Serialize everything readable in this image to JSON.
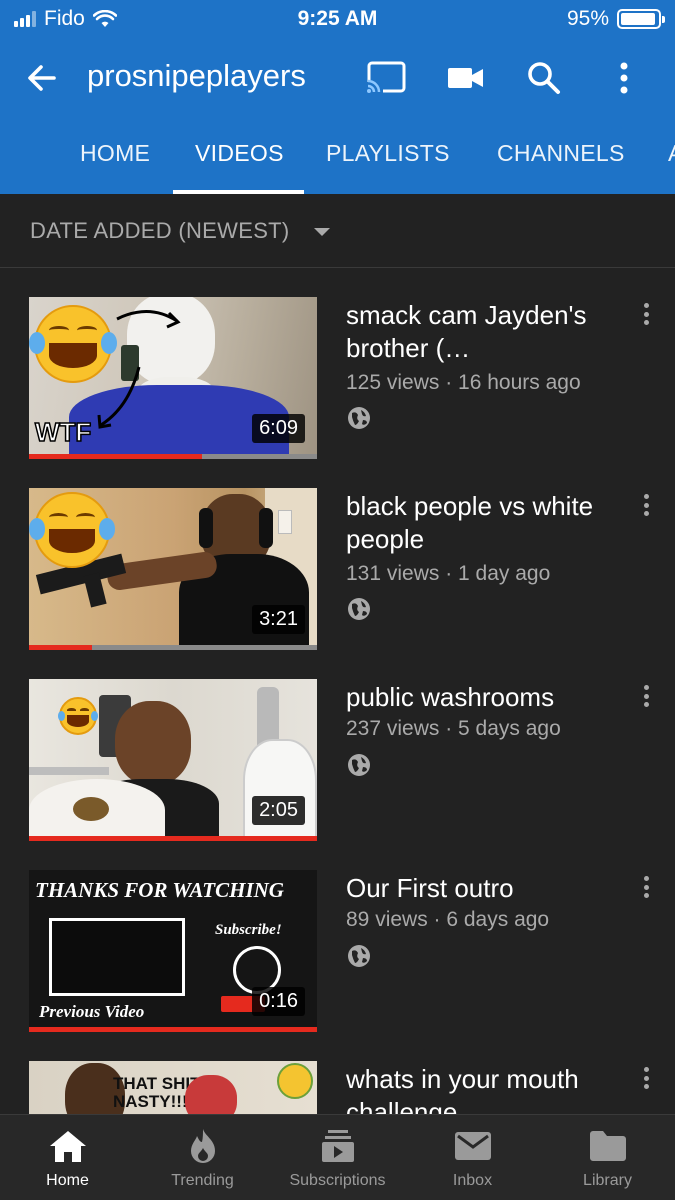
{
  "status": {
    "carrier": "Fido",
    "time": "9:25 AM",
    "battery": "95%",
    "battery_level": 0.95
  },
  "header": {
    "title": "prosnipeplayers"
  },
  "tabs": [
    {
      "label": "HOME"
    },
    {
      "label": "VIDEOS"
    },
    {
      "label": "PLAYLISTS"
    },
    {
      "label": "CHANNELS"
    }
  ],
  "sort": {
    "label": "DATE ADDED (NEWEST)"
  },
  "videos": [
    {
      "title": "smack cam Jayden's  brother (…",
      "meta": "125 views · 16 hours ago",
      "duration": "6:09",
      "progress": 0.6,
      "thumb_text": "WTF"
    },
    {
      "title": "black people vs white people",
      "meta": "131 views · 1 day ago",
      "duration": "3:21",
      "progress": 0.22
    },
    {
      "title": "public washrooms",
      "meta": "237 views · 5 days ago",
      "duration": "2:05",
      "progress": 1.0
    },
    {
      "title": "Our First outro",
      "meta": "89 views · 6 days ago",
      "duration": "0:16",
      "progress": 1.0,
      "thumb_title": "THANKS FOR WATCHING",
      "thumb_subscribe": "Subscribe!",
      "thumb_prev": "Previous Video"
    },
    {
      "title": "whats in your mouth challenge",
      "thumb_text": "THAT SHIT NASTY!!!"
    }
  ],
  "bottom_nav": [
    {
      "label": "Home",
      "icon": "home-icon"
    },
    {
      "label": "Trending",
      "icon": "trending-icon"
    },
    {
      "label": "Subscriptions",
      "icon": "subscriptions-icon"
    },
    {
      "label": "Inbox",
      "icon": "inbox-icon"
    },
    {
      "label": "Library",
      "icon": "library-icon"
    }
  ],
  "colors": {
    "brand": "#1e73c7",
    "background": "#222222",
    "progress": "#e52a1e"
  }
}
